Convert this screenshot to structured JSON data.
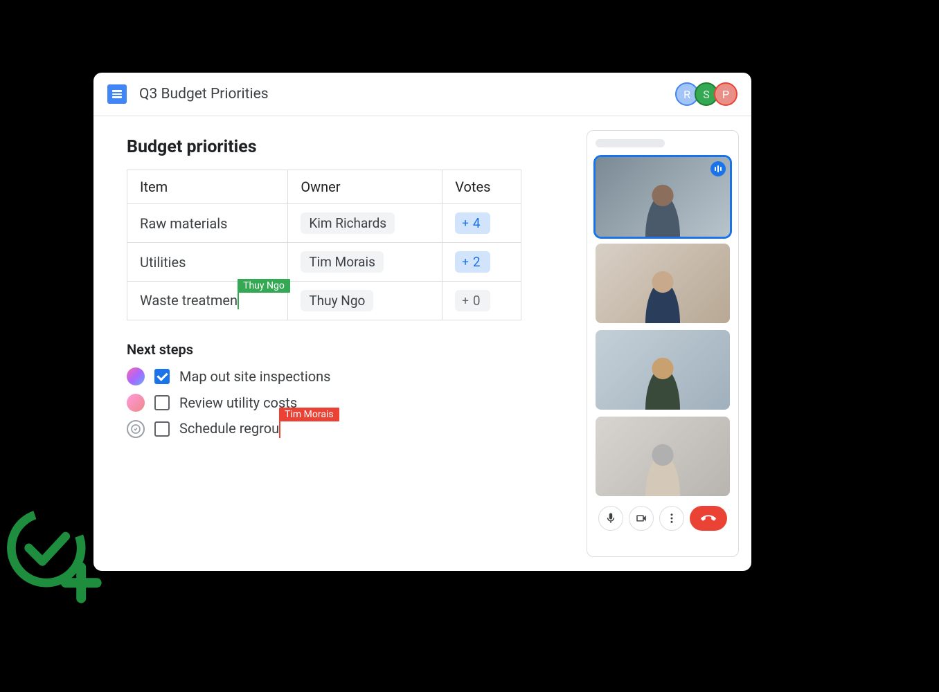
{
  "header": {
    "doc_title": "Q3 Budget Priorities",
    "collaborators": [
      {
        "initial": "R",
        "color": "blue"
      },
      {
        "initial": "S",
        "color": "green"
      },
      {
        "initial": "P",
        "color": "red"
      }
    ]
  },
  "section_title": "Budget priorities",
  "table": {
    "headers": {
      "item": "Item",
      "owner": "Owner",
      "votes": "Votes"
    },
    "rows": [
      {
        "item": "Raw materials",
        "owner": "Kim Richards",
        "votes": 4,
        "active": true
      },
      {
        "item": "Utilities",
        "owner": "Tim Morais",
        "votes": 2,
        "active": true
      },
      {
        "item": "Waste treatmen",
        "owner": "Thuy Ngo",
        "votes": 0,
        "active": false
      }
    ],
    "editing_cursor": {
      "row": 2,
      "user": "Thuy Ngo"
    }
  },
  "next_steps": {
    "title": "Next steps",
    "items": [
      {
        "text": "Map out site inspections",
        "checked": true
      },
      {
        "text": "Review utility costs",
        "checked": false
      },
      {
        "text": "Schedule regrou",
        "checked": false
      }
    ],
    "editing_cursor": {
      "item": 2,
      "user": "Tim Morais"
    }
  },
  "meet": {
    "participants": 4,
    "speaking_index": 0
  }
}
